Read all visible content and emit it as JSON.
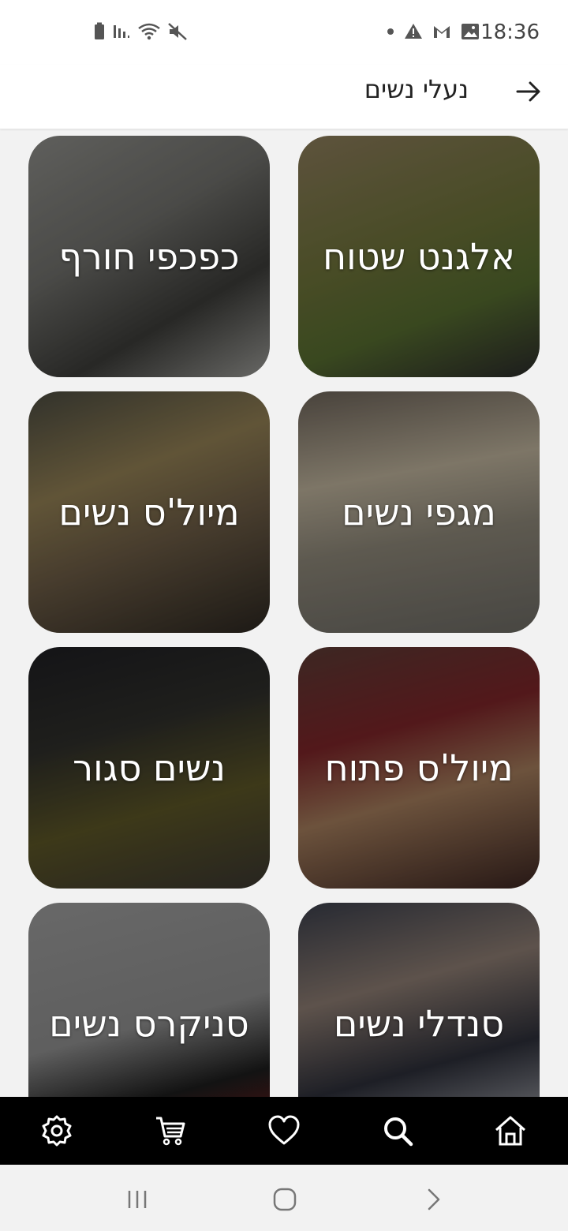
{
  "status_bar": {
    "time": "18:36",
    "left_icons": [
      "battery-icon",
      "signal-icon",
      "wifi-icon",
      "mute-icon"
    ],
    "right_icons": [
      "dot-icon",
      "warning-icon",
      "gmail-icon",
      "image-icon"
    ]
  },
  "header": {
    "title": "נעלי נשים",
    "back_icon": "arrow-right-icon"
  },
  "categories": [
    {
      "label": "אלגנט שטוח"
    },
    {
      "label": "כפכפי חורף"
    },
    {
      "label": "מגפי נשים"
    },
    {
      "label": "מיול'ס נשים"
    },
    {
      "label": "מיול'ס פתוח"
    },
    {
      "label": "נשים סגור"
    },
    {
      "label": "סנדלי נשים"
    },
    {
      "label": "סניקרס נשים"
    }
  ],
  "bottom_nav": [
    "home-icon",
    "search-icon",
    "heart-icon",
    "cart-icon",
    "settings-icon"
  ],
  "system_nav": [
    "back-icon",
    "home-circle-icon",
    "recents-icon"
  ],
  "colors": {
    "nav_bg": "#000000",
    "header_bg": "#ffffff",
    "page_bg": "#f2f2f2"
  }
}
